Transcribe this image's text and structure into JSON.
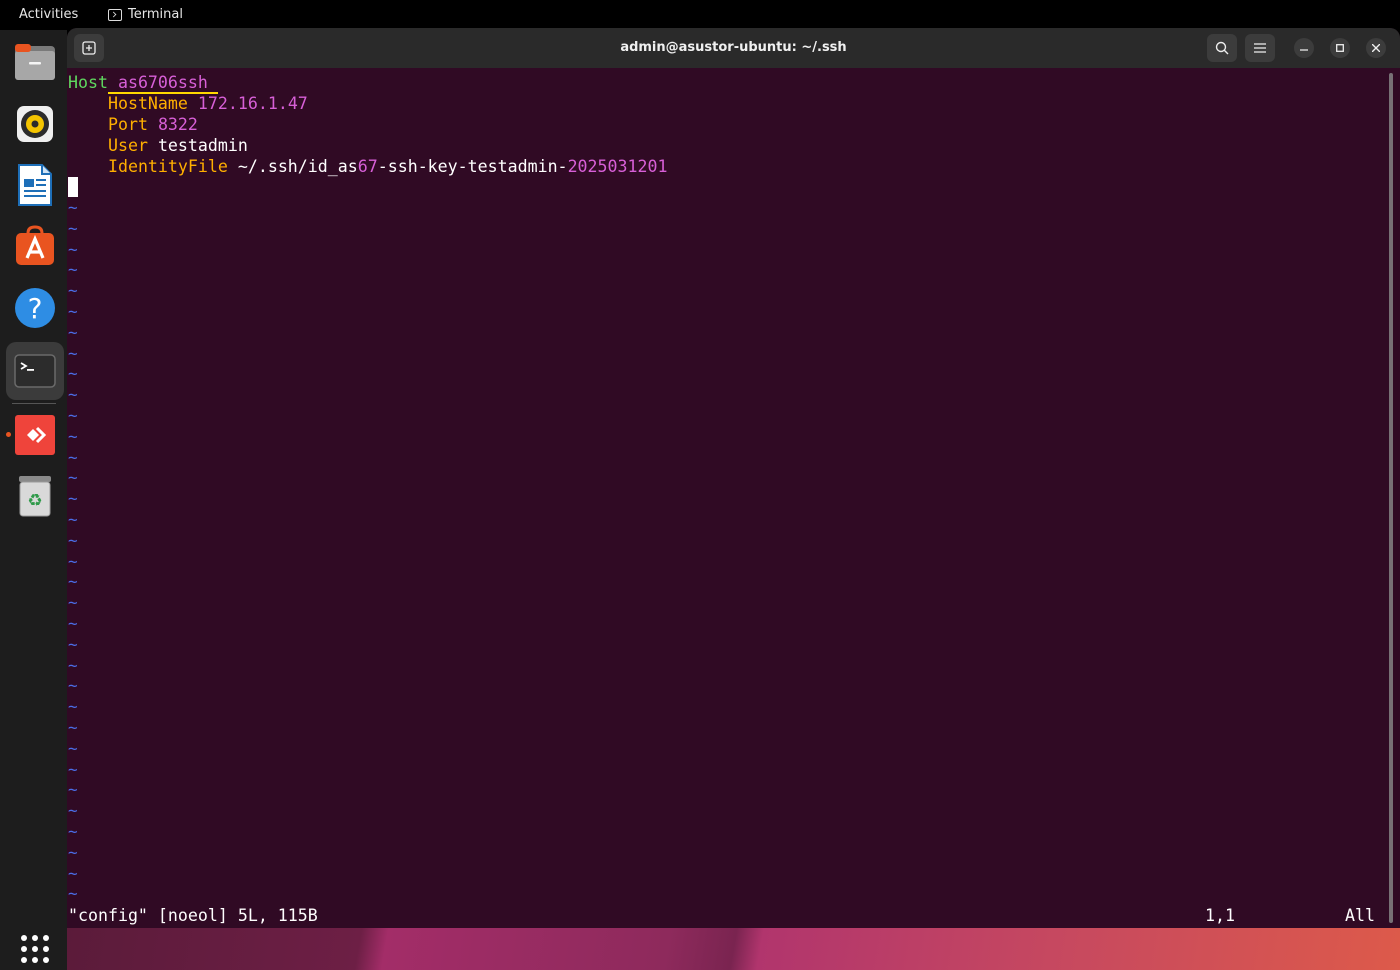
{
  "topbar": {
    "activities": "Activities",
    "app_name": "Terminal"
  },
  "window": {
    "title": "admin@asustor-ubuntu: ~/.ssh"
  },
  "dock": {
    "items": [
      {
        "name": "files",
        "icon": "files-icon"
      },
      {
        "name": "rhythmbox",
        "icon": "rhythmbox-icon"
      },
      {
        "name": "writer",
        "icon": "libreoffice-writer-icon"
      },
      {
        "name": "app-center",
        "icon": "app-center-icon"
      },
      {
        "name": "help",
        "icon": "help-icon"
      },
      {
        "name": "terminal",
        "icon": "terminal-icon"
      },
      {
        "name": "anydesk",
        "icon": "anydesk-icon"
      },
      {
        "name": "trash",
        "icon": "trash-icon"
      },
      {
        "name": "show-apps",
        "icon": "grid-icon"
      }
    ]
  },
  "editor": {
    "host_kw": "Host",
    "host_val": " as6706ssh ",
    "hostname_kw": "HostName",
    "hostname_val": "172.16.1.47",
    "port_kw": "Port",
    "port_val": "8322",
    "user_kw": "User",
    "user_val": "testadmin",
    "identity_kw": "IdentityFile",
    "identity_val_a": "~/.ssh/id_as",
    "identity_val_b": "67",
    "identity_val_c": "-ssh-key-testadmin-",
    "identity_val_d": "2025031201",
    "tilde": "~",
    "status": "\"config\" [noeol] 5L, 115B",
    "position": "1,1",
    "scroll": "All"
  },
  "colors": {
    "terminal_bg": "#300a24",
    "keyword_green": "#5fd75f",
    "keyword_yellow": "#ffaf00",
    "value_magenta": "#d75fd7",
    "tilde_blue": "#4b6ee8",
    "accent_orange": "#e95420"
  }
}
